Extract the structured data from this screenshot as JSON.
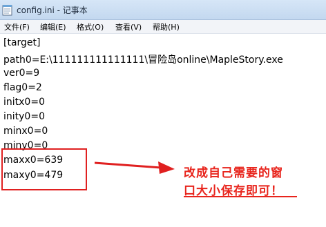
{
  "window": {
    "title": "config.ini - 记事本",
    "icon": "notepad-icon"
  },
  "menu": {
    "items": [
      "文件(F)",
      "编辑(E)",
      "格式(O)",
      "查看(V)",
      "帮助(H)"
    ]
  },
  "editor": {
    "lines": [
      "[target]",
      "path0=E:\\111111111111111\\冒险岛online\\MapleStory.exe",
      "ver0=9",
      "flag0=2",
      "initx0=0",
      "inity0=0",
      "minx0=0",
      "miny0=0",
      "maxx0=639",
      "maxy0=479"
    ]
  },
  "annotation": {
    "line1": "改成自己需要的窗",
    "line2": "口大小保存即可！",
    "color": "#e8241c"
  }
}
